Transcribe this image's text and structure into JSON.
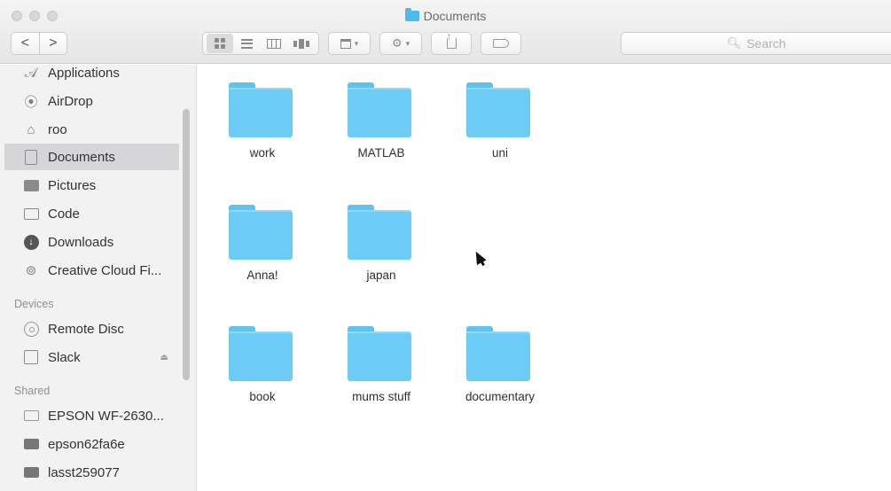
{
  "window": {
    "title": "Documents"
  },
  "toolbar": {
    "back_label": "<",
    "forward_label": ">",
    "search_placeholder": "Search"
  },
  "sidebar": {
    "favorites": [
      {
        "label": "Applications",
        "icon": "applications-icon"
      },
      {
        "label": "AirDrop",
        "icon": "airdrop-icon"
      },
      {
        "label": "roo",
        "icon": "home-icon"
      },
      {
        "label": "Documents",
        "icon": "documents-icon",
        "selected": true
      },
      {
        "label": "Pictures",
        "icon": "pictures-icon"
      },
      {
        "label": "Code",
        "icon": "folder-icon"
      },
      {
        "label": "Downloads",
        "icon": "downloads-icon"
      },
      {
        "label": "Creative Cloud Fi...",
        "icon": "creative-cloud-icon"
      }
    ],
    "devices_heading": "Devices",
    "devices": [
      {
        "label": "Remote Disc",
        "icon": "remote-disc-icon"
      },
      {
        "label": "Slack",
        "icon": "drive-icon",
        "eject": true
      }
    ],
    "shared_heading": "Shared",
    "shared": [
      {
        "label": "EPSON WF-2630...",
        "icon": "printer-icon"
      },
      {
        "label": "epson62fa6e",
        "icon": "computer-icon"
      },
      {
        "label": "lasst259077",
        "icon": "computer-icon"
      }
    ]
  },
  "folders": [
    {
      "name": "work"
    },
    {
      "name": "MATLAB"
    },
    {
      "name": "uni"
    },
    {
      "name": "Anna!"
    },
    {
      "name": "japan"
    },
    {
      "name": "book"
    },
    {
      "name": "mums stuff"
    },
    {
      "name": "documentary"
    }
  ],
  "colors": {
    "folder": "#6cccf6",
    "sidebar_bg": "#f2f2f3",
    "selection": "#d6d6d9"
  }
}
